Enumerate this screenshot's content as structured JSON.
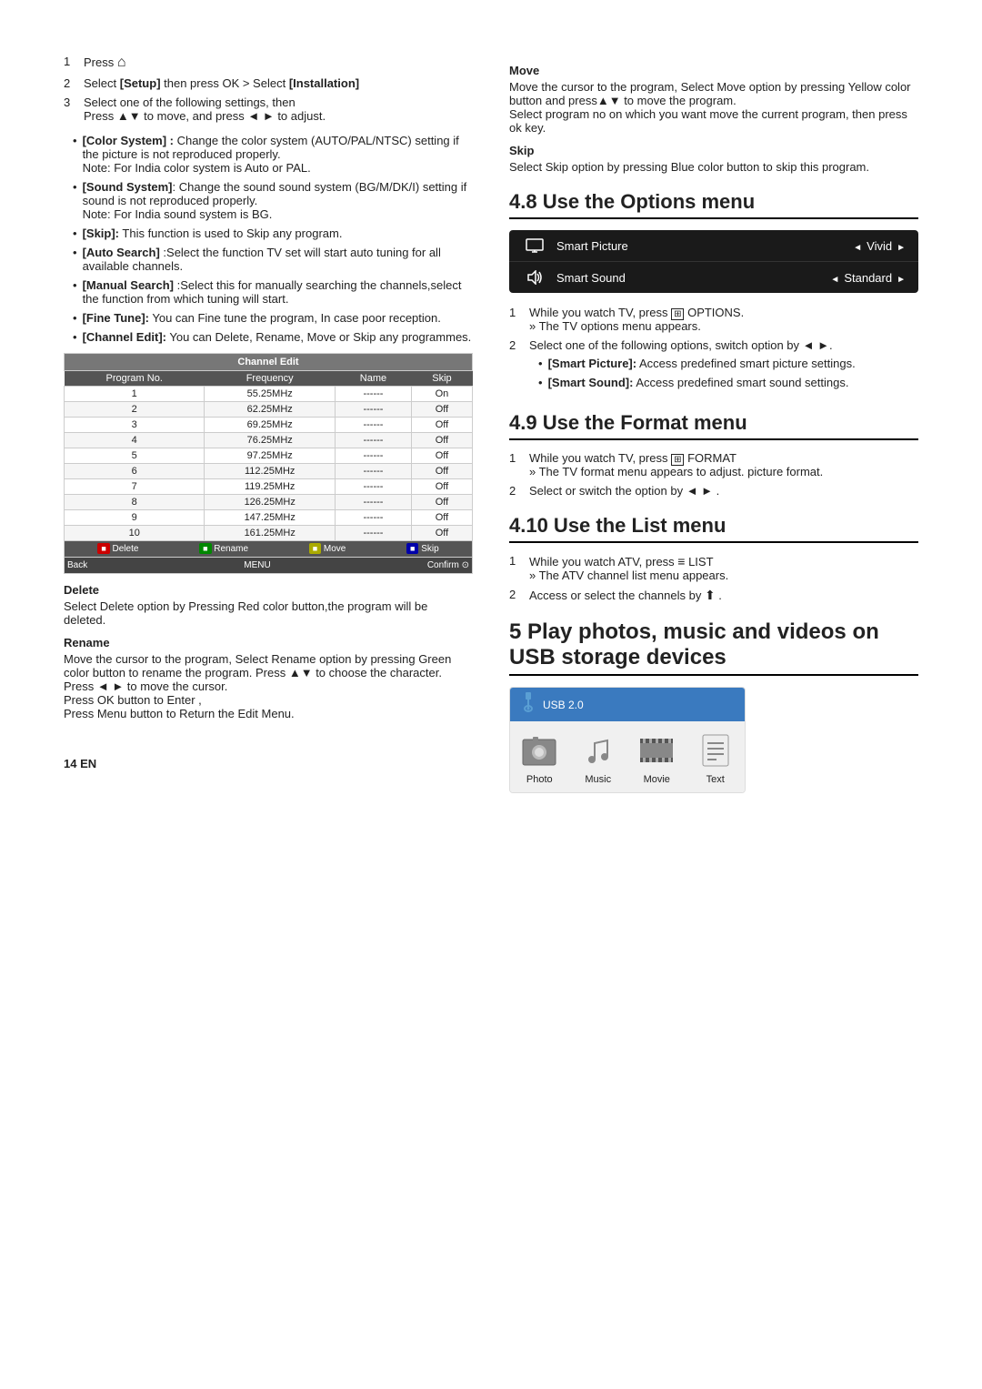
{
  "left": {
    "steps_intro": [
      {
        "num": "1",
        "text": "Press ⌂"
      },
      {
        "num": "2",
        "text": "Select [Setup] then press OK > Select [Installation]"
      },
      {
        "num": "3",
        "text": "Select one of the following settings, then Press ▲▼ to move, and press ◄ ► to adjust."
      }
    ],
    "bullets": [
      {
        "bold": "[Color System] :",
        "rest": " Change the color system (AUTO/PAL/NTSC) setting if the picture is not reproduced properly.\nNote: For India color system is Auto or PAL."
      },
      {
        "bold": "[Sound System]",
        "rest": ": Change the sound sound system (BG/M/DK/I) setting if sound is not reproduced properly.\nNote: For India sound system is BG."
      },
      {
        "bold": "[Skip]:",
        "rest": "This function is used to Skip any program."
      },
      {
        "bold": "[Auto Search]",
        "rest": ":Select the function TV set will start auto tuning for all available channels."
      },
      {
        "bold": "[Manual Search]",
        "rest": ":Select this for manually searching the channels,select the function from which tuning will start."
      },
      {
        "bold": "[Fine Tune]:",
        "rest": " You can Fine tune the program, In case poor reception."
      },
      {
        "bold": "[Channel Edit]:",
        "rest": " You can Delete, Rename, Move or Skip any programmes."
      }
    ],
    "channel_edit_title": "Channel Edit",
    "channel_table_headers": [
      "Program No.",
      "Frequency",
      "Name",
      "Skip"
    ],
    "channel_table_rows": [
      [
        "1",
        "55.25MHz",
        "------",
        "On"
      ],
      [
        "2",
        "62.25MHz",
        "------",
        "Off"
      ],
      [
        "3",
        "69.25MHz",
        "------",
        "Off"
      ],
      [
        "4",
        "76.25MHz",
        "------",
        "Off"
      ],
      [
        "5",
        "97.25MHz",
        "------",
        "Off"
      ],
      [
        "6",
        "112.25MHz",
        "------",
        "Off"
      ],
      [
        "7",
        "119.25MHz",
        "------",
        "Off"
      ],
      [
        "8",
        "126.25MHz",
        "------",
        "Off"
      ],
      [
        "9",
        "147.25MHz",
        "------",
        "Off"
      ],
      [
        "10",
        "161.25MHz",
        "------",
        "Off"
      ]
    ],
    "table_footer": [
      {
        "color": "red",
        "label": "Delete"
      },
      {
        "color": "green",
        "label": "Rename"
      },
      {
        "color": "yellow",
        "label": "Move"
      },
      {
        "color": "blue",
        "label": "Skip"
      }
    ],
    "delete_heading": "Delete",
    "delete_text": "Select Delete option by Pressing Red color button,the program will be deleted.",
    "rename_heading": "Rename",
    "rename_text": "Move the cursor to the program, Select Rename option by pressing Green color button to rename the program. Press ▲▼ to choose the character. Press ◄ ► to move the cursor.\nPress OK button to Enter ,\nPress Menu button to Return the Edit Menu.",
    "page_number": "14 EN"
  },
  "right": {
    "move_heading": "Move",
    "move_text": "Move the cursor to the program, Select Move option by pressing Yellow color button and press▲▼ to move the program.\nSelect program no on which you want move the current program, then press ok key.",
    "skip_heading": "Skip",
    "skip_text": "Select Skip option by pressing Blue color button to skip this program.",
    "section_48": "4.8 Use the Options menu",
    "options_panel": [
      {
        "icon": "monitor",
        "label": "Smart Picture",
        "value": "Vivid"
      },
      {
        "icon": "sound",
        "label": "Smart Sound",
        "value": "Standard"
      }
    ],
    "options_steps": [
      {
        "num": "1",
        "text": "While you watch TV, press ⊞ OPTIONS.",
        "sub": "» The TV options menu appears."
      },
      {
        "num": "2",
        "text": "Select one of the following options, switch option by ◄ ►.",
        "bullets": [
          {
            "bold": "[Smart Picture]:",
            "rest": "Access predefined smart picture settings."
          },
          {
            "bold": "[Smart Sound]:",
            "rest": " Access predefined smart sound settings."
          }
        ]
      }
    ],
    "section_49": "4.9 Use the Format menu",
    "format_steps": [
      {
        "num": "1",
        "text": "While you watch TV, press ⊞ FORMAT",
        "sub": "» The TV format menu appears to adjust. picture format."
      },
      {
        "num": "2",
        "text": "Select or switch the option by ◄ ►."
      }
    ],
    "section_410": "4.10 Use the List menu",
    "list_steps": [
      {
        "num": "1",
        "text": "While you watch ATV, press ≡ LIST",
        "sub": "» The ATV channel list menu appears."
      },
      {
        "num": "2",
        "text": "Access or select the channels by ⬆."
      }
    ],
    "section_5": "5 Play photos, music and videos on USB storage devices",
    "usb_header": "USB 2.0",
    "usb_icons": [
      {
        "icon": "photo",
        "label": "Photo"
      },
      {
        "icon": "music",
        "label": "Music"
      },
      {
        "icon": "movie",
        "label": "Movie"
      },
      {
        "icon": "text",
        "label": "Text"
      }
    ]
  }
}
